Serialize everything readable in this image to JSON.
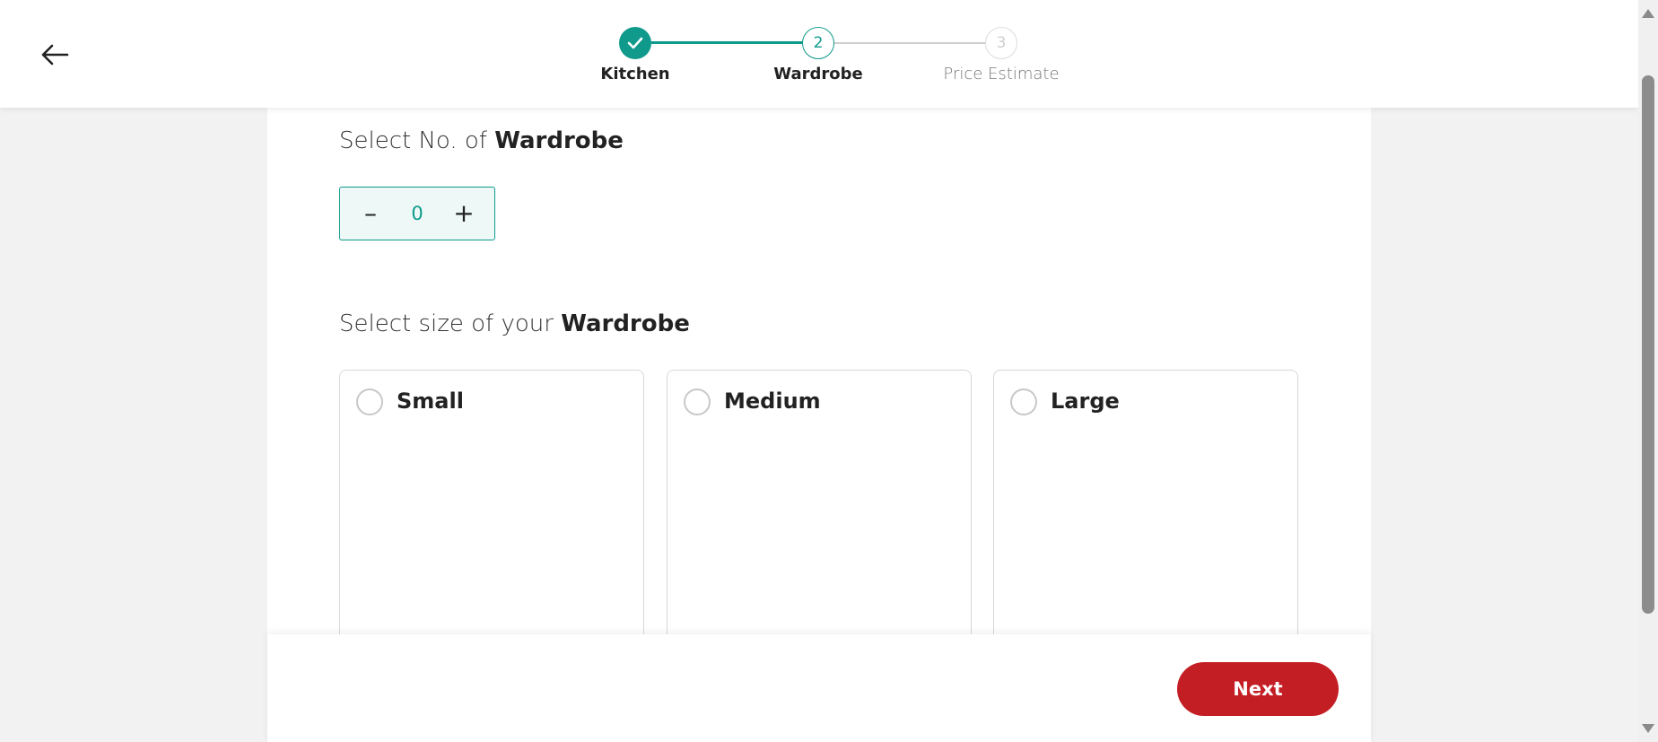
{
  "header": {
    "back_icon": "arrow-left-icon",
    "steps": [
      {
        "number": "1",
        "label": "Kitchen",
        "state": "completed",
        "icon": "check-icon"
      },
      {
        "number": "2",
        "label": "Wardrobe",
        "state": "active"
      },
      {
        "number": "3",
        "label": "Price Estimate",
        "state": "pending"
      }
    ]
  },
  "count_section": {
    "heading_prefix": "Select No. of ",
    "heading_bold": "Wardrobe",
    "decrement_label": "–",
    "value": "0",
    "increment_label": "+"
  },
  "size_section": {
    "heading_prefix": "Select size of your ",
    "heading_bold": "Wardrobe",
    "options": [
      {
        "label": "Small",
        "selected": false
      },
      {
        "label": "Medium",
        "selected": false
      },
      {
        "label": "Large",
        "selected": false
      }
    ]
  },
  "footer": {
    "next_label": "Next"
  },
  "colors": {
    "accent_teal": "#0f9a8c",
    "primary_red": "#c41e25",
    "inactive_gray": "#cfcfcf"
  }
}
